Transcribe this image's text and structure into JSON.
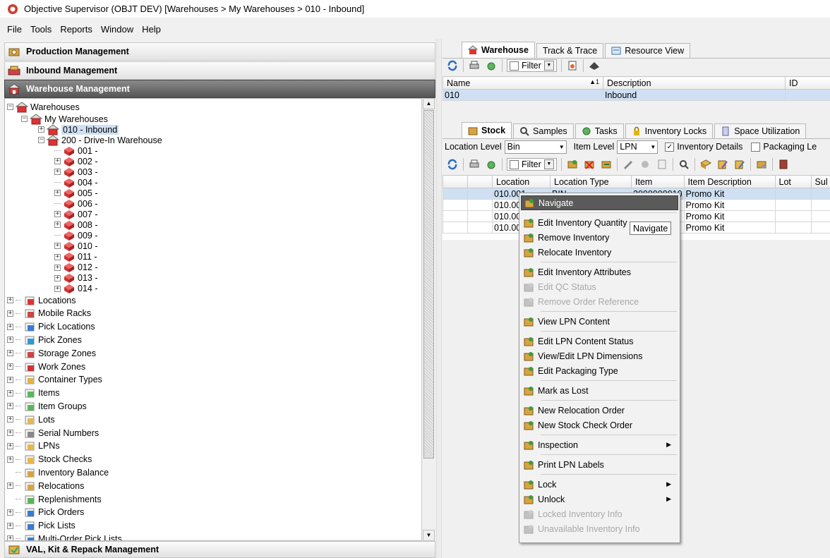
{
  "window": {
    "title": "Objective Supervisor (OBJT DEV) [Warehouses > My Warehouses > 010 - Inbound]"
  },
  "menu": [
    "File",
    "Tools",
    "Reports",
    "Window",
    "Help"
  ],
  "sections": {
    "production": "Production Management",
    "inbound": "Inbound Management",
    "warehouse": "Warehouse Management",
    "val": "VAL, Kit & Repack Management"
  },
  "tree": {
    "warehouses": "Warehouses",
    "my_warehouses": "My Warehouses",
    "w010": "010 - Inbound",
    "w200": "200 - Drive-In Warehouse",
    "zones": [
      "001 -",
      "002 -",
      "003 -",
      "004 -",
      "005 -",
      "006 -",
      "007 -",
      "008 -",
      "009 -",
      "010 -",
      "011 -",
      "012 -",
      "013 -",
      "014 -"
    ],
    "nodes": [
      "Locations",
      "Mobile Racks",
      "Pick Locations",
      "Pick Zones",
      "Storage Zones",
      "Work Zones",
      "Container Types",
      "Items",
      "Item Groups",
      "Lots",
      "Serial Numbers",
      "LPNs",
      "Stock Checks",
      "Inventory Balance",
      "Relocations",
      "Replenishments",
      "Pick Orders",
      "Pick Lists",
      "Multi-Order Pick Lists"
    ]
  },
  "top_tabs": [
    "Warehouse",
    "Track & Trace",
    "Resource View"
  ],
  "filter_label": "Filter",
  "top_grid": {
    "headers": [
      "Name",
      "Description",
      "ID"
    ],
    "sort_mark": "▲1",
    "row": [
      "010",
      "Inbound",
      ""
    ]
  },
  "bottom_tabs": [
    "Stock",
    "Samples",
    "Tasks",
    "Inventory Locks",
    "Space Utilization"
  ],
  "levels": {
    "location_label": "Location Level",
    "location_value": "Bin",
    "item_label": "Item Level",
    "item_value": "LPN",
    "details_label": "Inventory Details",
    "packaging_label": "Packaging Le"
  },
  "stock_grid": {
    "headers": [
      "Location",
      "Location Type",
      "Item",
      "Item Description",
      "Lot",
      "Sul"
    ],
    "rows": [
      [
        "010.001",
        "BIN",
        "3000000010",
        "Promo Kit"
      ],
      [
        "010.00",
        "",
        "",
        "Promo Kit"
      ],
      [
        "010.00",
        "",
        "",
        "Promo Kit"
      ],
      [
        "010.00",
        "",
        "",
        "Promo Kit"
      ]
    ]
  },
  "context_menu": [
    {
      "label": "Navigate",
      "icon": "navigate-icon",
      "state": "highlighted"
    },
    {
      "label": "Edit Inventory Quantity",
      "icon": "edit-quantity-icon"
    },
    {
      "label": "Remove Inventory",
      "icon": "remove-inventory-icon"
    },
    {
      "label": "Relocate Inventory",
      "icon": "relocate-icon"
    },
    {
      "label": "Edit Inventory Attributes",
      "icon": "edit-attributes-icon"
    },
    {
      "label": "Edit QC Status",
      "icon": "qc-status-icon",
      "state": "disabled"
    },
    {
      "label": "Remove Order Reference",
      "icon": "order-reference-icon",
      "state": "disabled"
    },
    {
      "label": "View LPN Content",
      "icon": "view-lpn-icon"
    },
    {
      "label": "Edit LPN Content Status",
      "icon": "lpn-status-icon"
    },
    {
      "label": "View/Edit LPN Dimensions",
      "icon": "lpn-dimensions-icon"
    },
    {
      "label": "Edit Packaging Type",
      "icon": "packaging-icon"
    },
    {
      "label": "Mark as Lost",
      "icon": "lost-icon"
    },
    {
      "label": "New Relocation Order",
      "icon": "relocation-order-icon"
    },
    {
      "label": "New Stock Check Order",
      "icon": "stock-check-icon"
    },
    {
      "label": "Inspection",
      "icon": "inspection-icon",
      "submenu": true
    },
    {
      "label": "Print LPN Labels",
      "icon": "print-icon"
    },
    {
      "label": "Lock",
      "icon": "lock-icon",
      "submenu": true
    },
    {
      "label": "Unlock",
      "icon": "unlock-icon",
      "submenu": true
    },
    {
      "label": "Locked Inventory Info",
      "icon": "locked-info-icon",
      "state": "disabled"
    },
    {
      "label": "Unavailable Inventory Info",
      "icon": "unavailable-info-icon",
      "state": "disabled"
    }
  ],
  "tooltip": "Navigate",
  "colors": {
    "selection": "#cfe0f4",
    "highlight": "#5a5a5a",
    "section_active": "#555555"
  }
}
